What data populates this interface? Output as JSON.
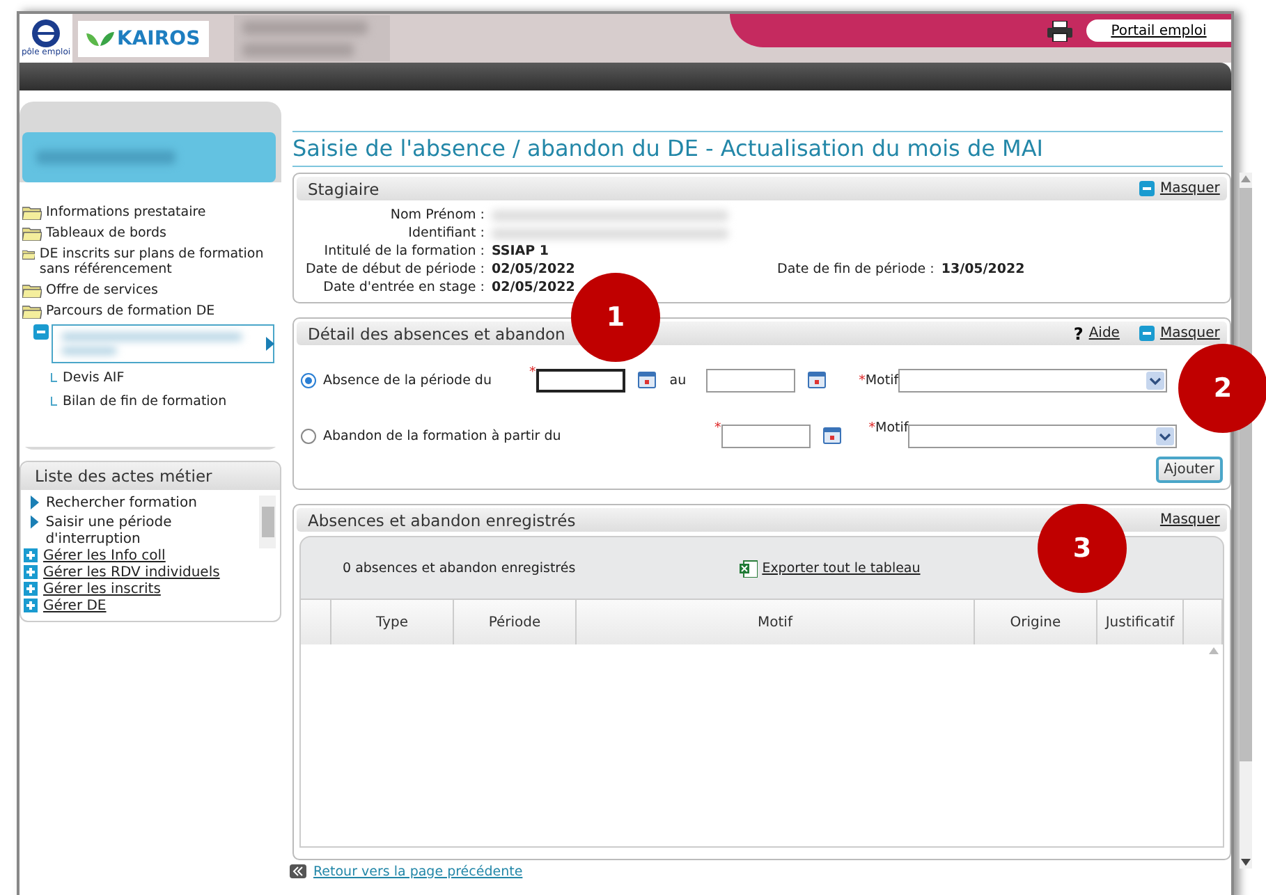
{
  "header": {
    "logo_caption": "pôle emploi",
    "brand": "KAIROS",
    "portal_link": "Portail emploi"
  },
  "sidebar": {
    "nav": [
      {
        "label": "Informations prestataire"
      },
      {
        "label": "Tableaux de bords"
      },
      {
        "label": "DE inscrits sur plans de formation sans référencement"
      },
      {
        "label": "Offre de services"
      },
      {
        "label": "Parcours de formation DE"
      }
    ],
    "sub_items": [
      "Devis AIF",
      "Bilan de fin de formation"
    ],
    "actions": {
      "title": "Liste des actes métier",
      "items": [
        "Rechercher formation",
        "Saisir une période d'interruption"
      ],
      "links": [
        "Gérer les Info coll",
        "Gérer les RDV individuels",
        "Gérer les inscrits",
        "Gérer DE"
      ]
    }
  },
  "main": {
    "title": "Saisie de l'absence / abandon du DE - Actualisation du mois de MAI",
    "stagiaire": {
      "title": "Stagiaire",
      "hide": "Masquer",
      "fields": [
        {
          "label": "Nom Prénom :",
          "kind": "redacted"
        },
        {
          "label": "Identifiant :",
          "kind": "redacted"
        },
        {
          "label": "Intitulé de la formation :",
          "kind": "text",
          "value": "SSIAP 1"
        },
        {
          "label": "Date de début de période :",
          "kind": "text",
          "value": "02/05/2022",
          "extra_label": "Date de fin de période :",
          "extra_value": "13/05/2022"
        },
        {
          "label": "Date d'entrée en stage :",
          "kind": "text",
          "value": "02/05/2022"
        }
      ]
    },
    "detail": {
      "title": "Détail des absences et abandon",
      "help_icon": "?",
      "help": "Aide",
      "hide": "Masquer",
      "rows": [
        {
          "label": "Absence de la période du",
          "selected": true,
          "marker": "*",
          "to_label": "au",
          "motif_marker": "*",
          "motif": "Motif"
        },
        {
          "label": "Abandon de la formation à partir du",
          "selected": false,
          "marker": "*",
          "motif_marker": "*",
          "motif": "Motif"
        }
      ],
      "add": "Ajouter"
    },
    "records": {
      "title": "Absences et abandon enregistrés",
      "hide": "Masquer",
      "count": "0 absences et abandon enregistrés",
      "export": "Exporter tout le tableau",
      "columns": [
        "Type",
        "Période",
        "Motif",
        "Origine",
        "Justificatif"
      ]
    },
    "back": "Retour vers la page précédente"
  },
  "callouts": [
    "1",
    "2",
    "3"
  ]
}
